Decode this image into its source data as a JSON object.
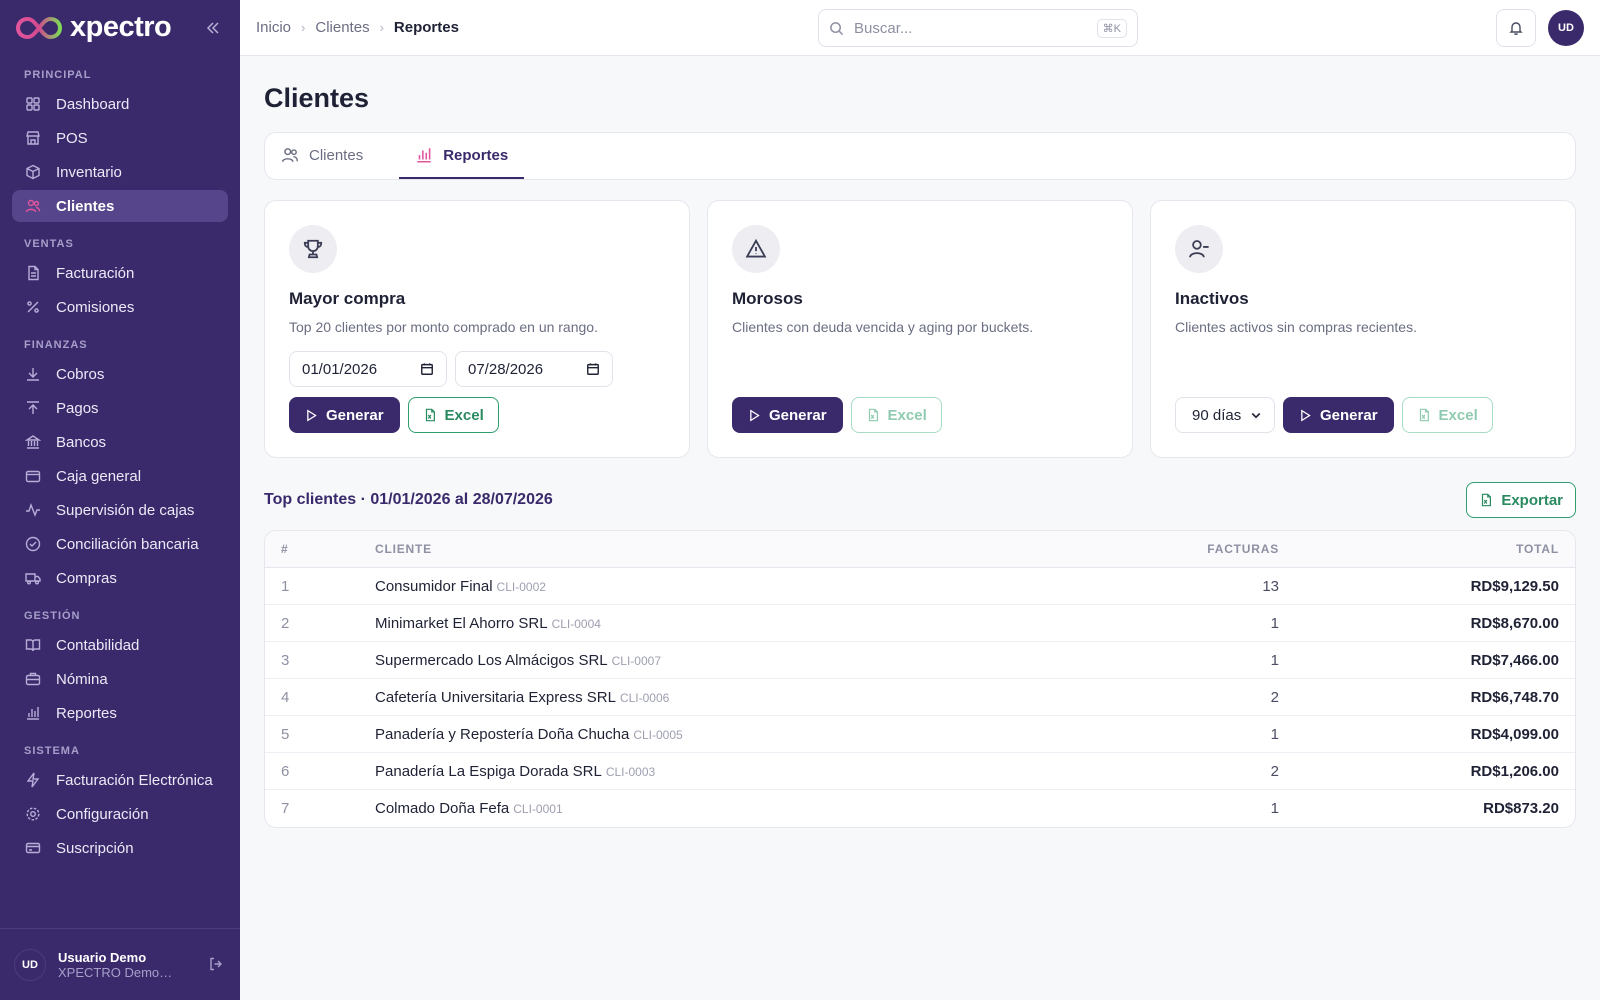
{
  "brand": {
    "name": "xpectro"
  },
  "sidebar": {
    "sections": [
      {
        "title": "PRINCIPAL",
        "items": [
          {
            "label": "Dashboard",
            "icon": "grid-icon"
          },
          {
            "label": "POS",
            "icon": "store-icon"
          },
          {
            "label": "Inventario",
            "icon": "box-icon"
          },
          {
            "label": "Clientes",
            "icon": "users-icon",
            "active": true
          }
        ]
      },
      {
        "title": "VENTAS",
        "items": [
          {
            "label": "Facturación",
            "icon": "file-icon"
          },
          {
            "label": "Comisiones",
            "icon": "percent-icon"
          }
        ]
      },
      {
        "title": "FINANZAS",
        "items": [
          {
            "label": "Cobros",
            "icon": "arrow-down-icon"
          },
          {
            "label": "Pagos",
            "icon": "arrow-up-icon"
          },
          {
            "label": "Bancos",
            "icon": "bank-icon"
          },
          {
            "label": "Caja general",
            "icon": "wallet-icon"
          },
          {
            "label": "Supervisión de cajas",
            "icon": "activity-icon"
          },
          {
            "label": "Conciliación bancaria",
            "icon": "check-circle-icon"
          },
          {
            "label": "Compras",
            "icon": "truck-icon"
          }
        ]
      },
      {
        "title": "GESTIÓN",
        "items": [
          {
            "label": "Contabilidad",
            "icon": "book-icon"
          },
          {
            "label": "Nómina",
            "icon": "briefcase-icon"
          },
          {
            "label": "Reportes",
            "icon": "bar-chart-icon"
          }
        ]
      },
      {
        "title": "SISTEMA",
        "items": [
          {
            "label": "Facturación Electrónica",
            "icon": "zap-icon"
          },
          {
            "label": "Configuración",
            "icon": "gear-icon"
          },
          {
            "label": "Suscripción",
            "icon": "credit-card-icon"
          }
        ]
      }
    ],
    "user": {
      "initials": "UD",
      "name": "Usuario Demo",
      "org": "XPECTRO Demo S..."
    }
  },
  "topbar": {
    "breadcrumbs": [
      "Inicio",
      "Clientes",
      "Reportes"
    ],
    "search_placeholder": "Buscar...",
    "search_shortcut": "⌘K",
    "avatar_initials": "UD"
  },
  "page": {
    "title": "Clientes",
    "tabs": [
      {
        "label": "Clientes",
        "active": false
      },
      {
        "label": "Reportes",
        "active": true
      }
    ]
  },
  "cards": {
    "mayor": {
      "title": "Mayor compra",
      "desc": "Top 20 clientes por monto comprado en un rango.",
      "date_from": "01/01/2026",
      "date_to": "07/28/2026",
      "generate": "Generar",
      "excel": "Excel"
    },
    "morosos": {
      "title": "Morosos",
      "desc": "Clientes con deuda vencida y aging por buckets.",
      "generate": "Generar",
      "excel": "Excel"
    },
    "inactivos": {
      "title": "Inactivos",
      "desc": "Clientes activos sin compras recientes.",
      "select_value": "90 días",
      "generate": "Generar",
      "excel": "Excel"
    }
  },
  "report": {
    "title": "Top clientes · 01/01/2026 al 28/07/2026",
    "export": "Exportar",
    "columns": {
      "num": "#",
      "cliente": "CLIENTE",
      "facturas": "FACTURAS",
      "total": "TOTAL"
    },
    "rows": [
      {
        "num": "1",
        "name": "Consumidor Final",
        "code": "CLI-0002",
        "facturas": "13",
        "total": "RD$9,129.50"
      },
      {
        "num": "2",
        "name": "Minimarket El Ahorro SRL",
        "code": "CLI-0004",
        "facturas": "1",
        "total": "RD$8,670.00"
      },
      {
        "num": "3",
        "name": "Supermercado Los Almácigos SRL",
        "code": "CLI-0007",
        "facturas": "1",
        "total": "RD$7,466.00"
      },
      {
        "num": "4",
        "name": "Cafetería Universitaria Express SRL",
        "code": "CLI-0006",
        "facturas": "2",
        "total": "RD$6,748.70"
      },
      {
        "num": "5",
        "name": "Panadería y Repostería Doña Chucha",
        "code": "CLI-0005",
        "facturas": "1",
        "total": "RD$4,099.00"
      },
      {
        "num": "6",
        "name": "Panadería La Espiga Dorada SRL",
        "code": "CLI-0003",
        "facturas": "2",
        "total": "RD$1,206.00"
      },
      {
        "num": "7",
        "name": "Colmado Doña Fefa",
        "code": "CLI-0001",
        "facturas": "1",
        "total": "RD$873.20"
      }
    ]
  },
  "colors": {
    "brand": "#3a2a6b",
    "accent": "#e3559c",
    "success": "#2f9e6e"
  }
}
